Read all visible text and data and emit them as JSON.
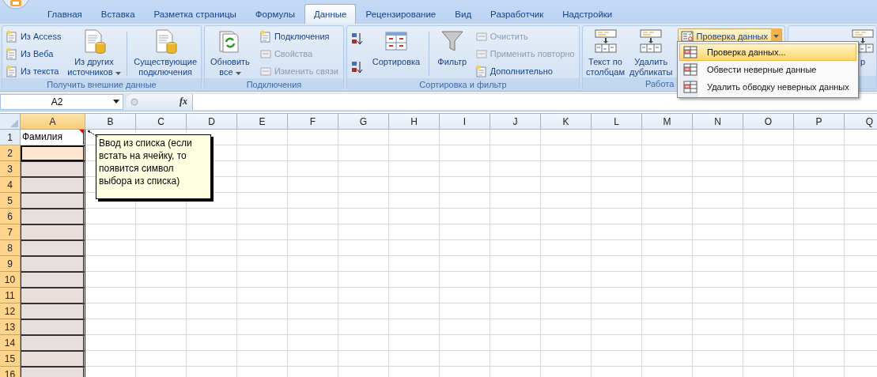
{
  "tabs": [
    {
      "label": "Главная",
      "selected": false
    },
    {
      "label": "Вставка",
      "selected": false
    },
    {
      "label": "Разметка страницы",
      "selected": false
    },
    {
      "label": "Формулы",
      "selected": false
    },
    {
      "label": "Данные",
      "selected": true
    },
    {
      "label": "Рецензирование",
      "selected": false
    },
    {
      "label": "Вид",
      "selected": false
    },
    {
      "label": "Разработчик",
      "selected": false
    },
    {
      "label": "Надстройки",
      "selected": false
    }
  ],
  "ribbon": {
    "groups": [
      {
        "title": "Получить внешние данные",
        "columns": [
          {
            "kind": "stack",
            "items": [
              {
                "label": "Из Access",
                "disabled": false
              },
              {
                "label": "Из Веба",
                "disabled": false
              },
              {
                "label": "Из текста",
                "disabled": false
              }
            ]
          },
          {
            "kind": "large",
            "label": "Из других\nисточников",
            "dropdown": true
          },
          {
            "kind": "separator"
          },
          {
            "kind": "large",
            "label": "Существующие\nподключения",
            "dropdown": false
          }
        ]
      },
      {
        "title": "Подключения",
        "columns": [
          {
            "kind": "large",
            "label": "Обновить\nвсе",
            "dropdown": true
          },
          {
            "kind": "stack",
            "items": [
              {
                "label": "Подключения",
                "disabled": false
              },
              {
                "label": "Свойства",
                "disabled": true
              },
              {
                "label": "Изменить связи",
                "disabled": true
              }
            ]
          }
        ]
      },
      {
        "title": "Сортировка и фильтр",
        "columns": [
          {
            "kind": "sort-pair"
          },
          {
            "kind": "large",
            "label": "Сортировка",
            "dropdown": false
          },
          {
            "kind": "separator"
          },
          {
            "kind": "large",
            "label": "Фильтр",
            "dropdown": false
          },
          {
            "kind": "stack",
            "items": [
              {
                "label": "Очистить",
                "disabled": true
              },
              {
                "label": "Применить повторно",
                "disabled": true
              },
              {
                "label": "Дополнительно",
                "disabled": false
              }
            ]
          }
        ]
      },
      {
        "title": "Работа",
        "columns": [
          {
            "kind": "large",
            "label": "Текст по\nстолбцам",
            "dropdown": false
          },
          {
            "kind": "large",
            "label": "Удалить\nдубликаты",
            "dropdown": false
          },
          {
            "kind": "split",
            "label": "Проверка данных",
            "pressed": true
          }
        ]
      },
      {
        "columns": [
          {
            "kind": "large",
            "label": "р",
            "dropdown": false
          }
        ]
      }
    ]
  },
  "menu": {
    "items": [
      {
        "label": "Проверка данных...",
        "selected": true
      },
      {
        "label": "Обвести неверные данные",
        "selected": false
      },
      {
        "label": "Удалить обводку неверных данных",
        "selected": false
      }
    ]
  },
  "name_box": {
    "value": "A2"
  },
  "formula_bar": {
    "function_label": "fx"
  },
  "sheet": {
    "columns": [
      {
        "label": "A",
        "selected": true
      },
      {
        "label": "B",
        "selected": false
      },
      {
        "label": "C",
        "selected": false
      },
      {
        "label": "D",
        "selected": false
      },
      {
        "label": "E",
        "selected": false
      },
      {
        "label": "F",
        "selected": false
      },
      {
        "label": "G",
        "selected": false
      },
      {
        "label": "H",
        "selected": false
      },
      {
        "label": "I",
        "selected": false
      },
      {
        "label": "J",
        "selected": false
      },
      {
        "label": "K",
        "selected": false
      },
      {
        "label": "L",
        "selected": false
      },
      {
        "label": "M",
        "selected": false
      },
      {
        "label": "N",
        "selected": false
      },
      {
        "label": "O",
        "selected": false
      },
      {
        "label": "P",
        "selected": false
      },
      {
        "label": "Q",
        "selected": false
      }
    ],
    "rows": [
      {
        "label": "1",
        "selected": false,
        "cell": {
          "text": "Фамилия",
          "shaded": false,
          "active": false
        }
      },
      {
        "label": "2",
        "selected": true,
        "cell": {
          "shaded": true,
          "active": true
        }
      },
      {
        "label": "3",
        "selected": true,
        "cell": {
          "shaded": true,
          "active": false
        }
      },
      {
        "label": "4",
        "selected": true,
        "cell": {
          "shaded": true,
          "active": false
        }
      },
      {
        "label": "5",
        "selected": true,
        "cell": {
          "shaded": true,
          "active": false
        }
      },
      {
        "label": "6",
        "selected": true,
        "cell": {
          "shaded": true,
          "active": false
        }
      },
      {
        "label": "7",
        "selected": true,
        "cell": {
          "shaded": true,
          "active": false
        }
      },
      {
        "label": "8",
        "selected": true,
        "cell": {
          "shaded": true,
          "active": false
        }
      },
      {
        "label": "9",
        "selected": true,
        "cell": {
          "shaded": true,
          "active": false
        }
      },
      {
        "label": "10",
        "selected": true,
        "cell": {
          "shaded": true,
          "active": false
        }
      },
      {
        "label": "11",
        "selected": true,
        "cell": {
          "shaded": true,
          "active": false
        }
      },
      {
        "label": "12",
        "selected": true,
        "cell": {
          "shaded": true,
          "active": false
        }
      },
      {
        "label": "13",
        "selected": true,
        "cell": {
          "shaded": true,
          "active": false
        }
      },
      {
        "label": "14",
        "selected": true,
        "cell": {
          "shaded": true,
          "active": false
        }
      },
      {
        "label": "15",
        "selected": true,
        "cell": {
          "shaded": true,
          "active": false
        }
      },
      {
        "label": "16",
        "selected": true,
        "cell": {
          "shaded": true,
          "active": false
        }
      }
    ]
  },
  "comment": {
    "text": "Ввод из списка (если встать на ячейку, то появится символ выбора из списка)"
  }
}
